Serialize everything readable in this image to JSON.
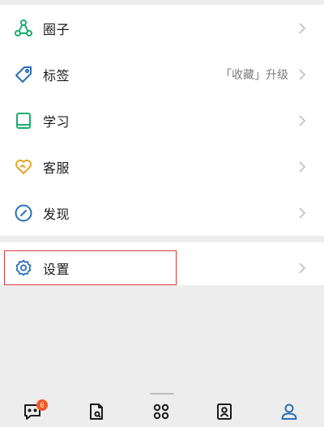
{
  "menu": {
    "items": [
      {
        "label": "圈子",
        "icon": "circle-network-icon",
        "color": "#1aad6e"
      },
      {
        "label": "标签",
        "icon": "tag-icon",
        "color": "#2a6fb4",
        "extra": "「收藏」升级"
      },
      {
        "label": "学习",
        "icon": "book-icon",
        "color": "#1aad6e"
      },
      {
        "label": "客服",
        "icon": "heart-handshake-icon",
        "color": "#e2a82a"
      },
      {
        "label": "发现",
        "icon": "compass-icon",
        "color": "#2a6fb4"
      }
    ],
    "settings": {
      "label": "设置",
      "icon": "gear-icon",
      "color": "#2a6fb4"
    }
  },
  "tabbar": {
    "items": [
      {
        "icon": "chat-icon",
        "badge": "6"
      },
      {
        "icon": "document-icon"
      },
      {
        "icon": "apps-grid-icon"
      },
      {
        "icon": "contacts-icon"
      },
      {
        "icon": "profile-icon",
        "color": "#2a6fb4"
      }
    ]
  },
  "colors": {
    "highlight": "#e03a3a",
    "badge": "#f05a23",
    "background": "#ededed"
  }
}
